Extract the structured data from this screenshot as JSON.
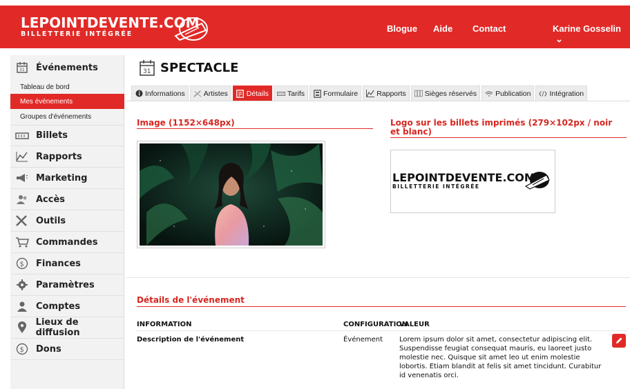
{
  "header": {
    "logo_main": "LEPOINTDEVENTE.COM",
    "logo_sub": "BILLETTERIE INTÉGRÉE",
    "nav": [
      "Blogue",
      "Aide",
      "Contact"
    ],
    "user": "Karine Gosselin",
    "user_caret": "⌄",
    "brand_color": "#e12a27"
  },
  "sidebar": {
    "events_label": "Événements",
    "sub_items": [
      "Tableau de bord",
      "Mes événements",
      "Groupes d'événements"
    ],
    "active_sub": "Mes événements",
    "items": [
      {
        "label": "Billets",
        "icon": "ticket-icon"
      },
      {
        "label": "Rapports",
        "icon": "chart-icon"
      },
      {
        "label": "Marketing",
        "icon": "megaphone-icon"
      },
      {
        "label": "Accès",
        "icon": "users-icon"
      },
      {
        "label": "Outils",
        "icon": "tools-icon"
      },
      {
        "label": "Commandes",
        "icon": "cart-icon"
      },
      {
        "label": "Finances",
        "icon": "dollar-icon"
      },
      {
        "label": "Paramètres",
        "icon": "gear-icon"
      },
      {
        "label": "Comptes",
        "icon": "user-icon"
      },
      {
        "label": "Lieux de diffusion",
        "icon": "location-icon"
      },
      {
        "label": "Dons",
        "icon": "dollar-icon"
      }
    ]
  },
  "page": {
    "title": "SPECTACLE",
    "tabs": [
      {
        "label": "Informations",
        "icon": "info-icon"
      },
      {
        "label": "Artistes",
        "icon": "artist-icon"
      },
      {
        "label": "Détails",
        "icon": "details-icon"
      },
      {
        "label": "Tarifs",
        "icon": "ticket-icon"
      },
      {
        "label": "Formulaire",
        "icon": "form-icon"
      },
      {
        "label": "Rapports",
        "icon": "chart-icon"
      },
      {
        "label": "Sièges réservés",
        "icon": "seats-icon"
      },
      {
        "label": "Publication",
        "icon": "wifi-icon"
      },
      {
        "label": "Intégration",
        "icon": "code-icon"
      }
    ],
    "active_tab": "Détails"
  },
  "image_section": {
    "title": "Image (1152×648px)"
  },
  "logo_section": {
    "title": "Logo sur les billets imprimés (279×102px / noir et blanc)",
    "logo_main": "LEPOINTDEVENTE.COM",
    "logo_sub": "BILLETTERIE INTÉGRÉE"
  },
  "details": {
    "title": "Détails de l'événement",
    "headers": {
      "information": "INFORMATION",
      "configuration": "CONFIGURATION",
      "value": "VALEUR"
    },
    "rows": [
      {
        "information": "Description de l'événement",
        "configuration": "Événement",
        "value_lines": [
          "Lorem ipsum dolor sit amet, consectetur adipiscing elit.",
          "Suspendisse feugiat consequat mauris, eu laoreet justo",
          "molestie nec. Quisque sit amet leo ut enim molestie",
          "lobortis. Etiam blandit at felis sit amet tincidunt. Curabitur",
          "id venenatis orci."
        ]
      }
    ]
  }
}
